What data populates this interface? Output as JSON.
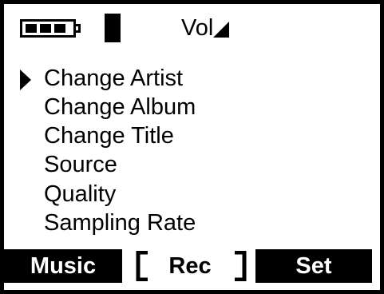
{
  "status_bar": {
    "battery_icon": "battery-three-quarters-icon",
    "signal_icon": "signal-bar-icon",
    "volume_label": "Vol",
    "volume_icon": "volume-wedge-icon"
  },
  "menu": {
    "cursor_icon": "triangle-right-cursor-icon",
    "selected_index": 0,
    "items": [
      {
        "label": "Change Artist"
      },
      {
        "label": "Change Album"
      },
      {
        "label": "Change Title"
      },
      {
        "label": "Source"
      },
      {
        "label": "Quality"
      },
      {
        "label": "Sampling Rate"
      }
    ]
  },
  "softkeys": {
    "left": "Music",
    "center": "Rec",
    "right": "Set"
  },
  "colors": {
    "foreground": "#000000",
    "background": "#ffffff"
  }
}
